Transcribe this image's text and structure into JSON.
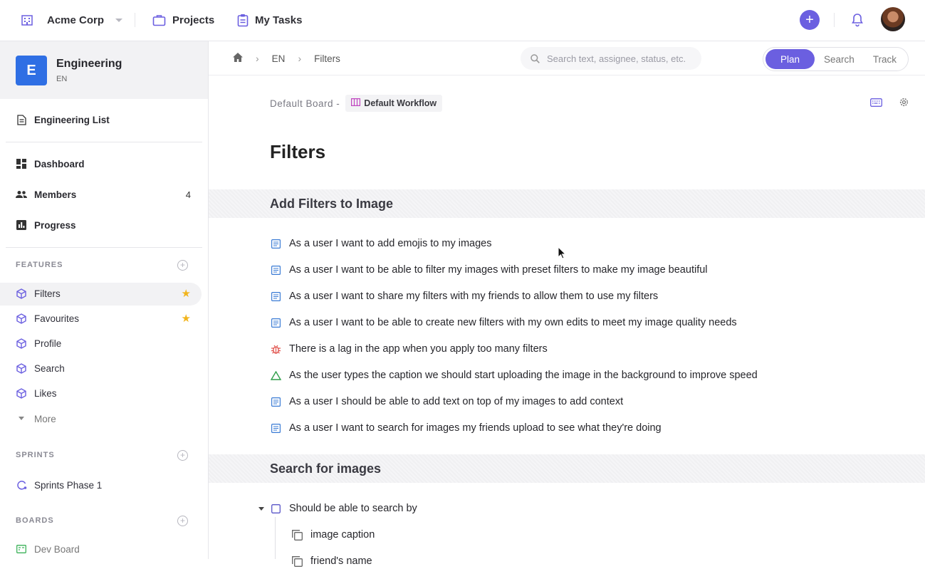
{
  "topbar": {
    "workspace": "Acme Corp",
    "nav": [
      {
        "label": "Projects",
        "icon": "briefcase-icon"
      },
      {
        "label": "My Tasks",
        "icon": "clipboard-icon"
      }
    ],
    "accent": "#6b5fe0"
  },
  "sidebar": {
    "project": {
      "badge": "E",
      "name": "Engineering",
      "key": "EN",
      "color": "#2f6fe4"
    },
    "list_item": "Engineering List",
    "nav": [
      {
        "label": "Dashboard"
      },
      {
        "label": "Members",
        "count": "4"
      },
      {
        "label": "Progress"
      }
    ],
    "features_title": "FEATURES",
    "features": [
      {
        "label": "Filters",
        "starred": true,
        "active": true
      },
      {
        "label": "Favourites",
        "starred": true
      },
      {
        "label": "Profile"
      },
      {
        "label": "Search"
      },
      {
        "label": "Likes"
      }
    ],
    "more": "More",
    "sprints_title": "SPRINTS",
    "sprints": [
      {
        "label": "Sprints Phase 1"
      }
    ],
    "boards_title": "BOARDS",
    "boards": [
      {
        "label": "Dev Board"
      }
    ]
  },
  "subbar": {
    "breadcrumbs": [
      "EN",
      "Filters"
    ],
    "search_placeholder": "Search text, assignee, status, etc.",
    "modes": [
      "Plan",
      "Search",
      "Track"
    ],
    "active_mode": "Plan"
  },
  "content": {
    "board": "Default Board -",
    "workflow": "Default Workflow",
    "title": "Filters",
    "groups": [
      {
        "title": "Add Filters to Image",
        "items": [
          {
            "type": "story",
            "text": "As a user I want to add emojis to my images"
          },
          {
            "type": "story",
            "text": "As a user I want to be able to filter my images with preset filters to make my image beautiful"
          },
          {
            "type": "story",
            "text": "As a user I want to share my filters with my friends to allow them to use my filters"
          },
          {
            "type": "story",
            "text": "As a user I want to be able to create new filters with my own edits to meet my image quality needs"
          },
          {
            "type": "bug",
            "text": "There is a lag in the app when you apply too many filters"
          },
          {
            "type": "improvement",
            "text": "As the user types the caption we should start uploading the image in the background to improve speed"
          },
          {
            "type": "story",
            "text": "As a user I should be able to add text on top of my images to add context"
          },
          {
            "type": "story",
            "text": "As a user I want to search for images my friends upload to see what they're doing"
          }
        ]
      },
      {
        "title": "Search for images",
        "items": [
          {
            "type": "task",
            "text": "Should be able to search by"
          },
          {
            "type": "subtask",
            "text": "image caption"
          },
          {
            "type": "subtask",
            "text": "friend's name"
          }
        ]
      }
    ]
  }
}
